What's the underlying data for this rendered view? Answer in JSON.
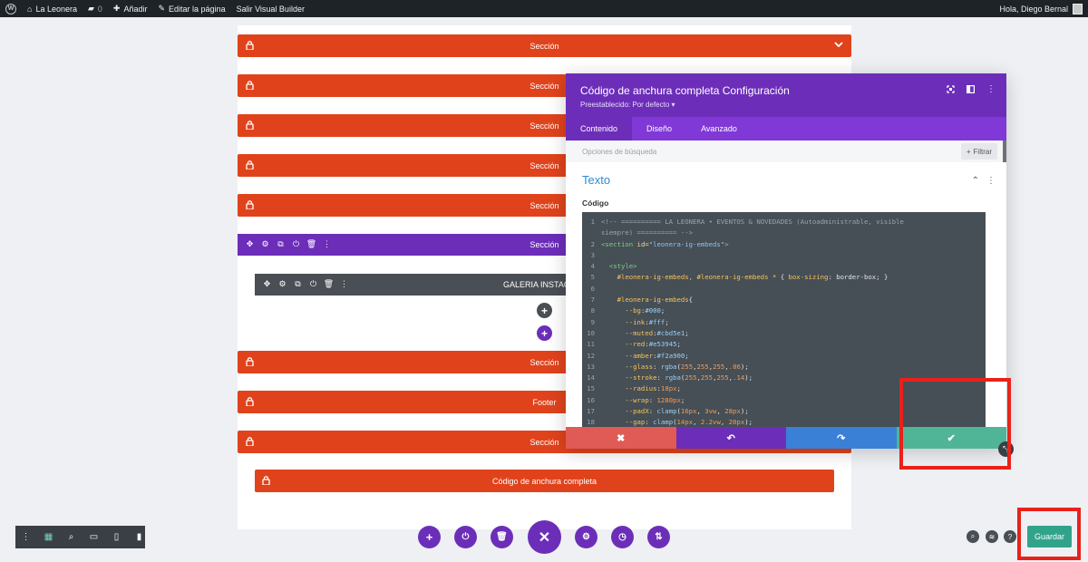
{
  "adminbar": {
    "site_name": "La Leonera",
    "comments_count": "0",
    "add_label": "Añadir",
    "edit_page_label": "Editar la página",
    "exit_builder_label": "Salir Visual Builder",
    "greeting": "Hola, Diego Bernal"
  },
  "builder": {
    "sections": [
      "Sección",
      "Sección",
      "Sección",
      "Sección",
      "Sección",
      "Sección",
      "Sección",
      "Footer",
      "Sección"
    ],
    "row_module_label": "GALERIA INSTAGR",
    "fullwidth_module_label": "Código de anchura completa"
  },
  "modal": {
    "title": "Código de anchura completa Configuración",
    "preset": "Preestablecido: Por defecto",
    "tabs": [
      "Contenido",
      "Diseño",
      "Avanzado"
    ],
    "active_tab": "Contenido",
    "search_placeholder": "Opciones de búsqueda",
    "filter_label": "Filtrar",
    "group_title": "Texto",
    "code_label": "Código",
    "code_lines": [
      {
        "n": "1",
        "parts": [
          [
            "cm",
            "<!-- ========== LA LEONERA • EVENTOS & NOVEDADES (Autoadministrable, visible"
          ]
        ]
      },
      {
        "n": "",
        "parts": [
          [
            "cm",
            "siempre) ========== -->"
          ]
        ]
      },
      {
        "n": "2",
        "parts": [
          [
            "tg",
            "<section "
          ],
          [
            "at",
            "id="
          ],
          [
            "st",
            "\"leonera-ig-embeds\""
          ],
          [
            "tg",
            ">"
          ]
        ]
      },
      {
        "n": "3",
        "parts": []
      },
      {
        "n": "4",
        "parts": [
          [
            "pl",
            "  "
          ],
          [
            "tg",
            "<style>"
          ]
        ]
      },
      {
        "n": "5",
        "parts": [
          [
            "pl",
            "    "
          ],
          [
            "sel",
            "#leonera-ig-embeds, #leonera-ig-embeds * "
          ],
          [
            "pl",
            "{ "
          ],
          [
            "pr",
            "box-sizing"
          ],
          [
            "pl",
            ": border-box; }"
          ]
        ]
      },
      {
        "n": "6",
        "parts": []
      },
      {
        "n": "7",
        "parts": [
          [
            "pl",
            "    "
          ],
          [
            "sel",
            "#leonera-ig-embeds"
          ],
          [
            "pl",
            "{"
          ]
        ]
      },
      {
        "n": "8",
        "parts": [
          [
            "pl",
            "      "
          ],
          [
            "pr",
            "--bg"
          ],
          [
            "pl",
            ":"
          ],
          [
            "vl",
            "#000"
          ],
          [
            "pl",
            ";"
          ]
        ]
      },
      {
        "n": "9",
        "parts": [
          [
            "pl",
            "      "
          ],
          [
            "pr",
            "--ink"
          ],
          [
            "pl",
            ":"
          ],
          [
            "vl",
            "#fff"
          ],
          [
            "pl",
            ";"
          ]
        ]
      },
      {
        "n": "10",
        "parts": [
          [
            "pl",
            "      "
          ],
          [
            "pr",
            "--muted"
          ],
          [
            "pl",
            ":"
          ],
          [
            "vl",
            "#cbd5e1"
          ],
          [
            "pl",
            ";"
          ]
        ]
      },
      {
        "n": "11",
        "parts": [
          [
            "pl",
            "      "
          ],
          [
            "pr",
            "--red"
          ],
          [
            "pl",
            ":"
          ],
          [
            "vl",
            "#e53945"
          ],
          [
            "pl",
            ";"
          ]
        ]
      },
      {
        "n": "12",
        "parts": [
          [
            "pl",
            "      "
          ],
          [
            "pr",
            "--amber"
          ],
          [
            "pl",
            ":"
          ],
          [
            "vl",
            "#f2a900"
          ],
          [
            "pl",
            ";"
          ]
        ]
      },
      {
        "n": "13",
        "parts": [
          [
            "pl",
            "      "
          ],
          [
            "pr",
            "--glass"
          ],
          [
            "pl",
            ": "
          ],
          [
            "vl",
            "rgba"
          ],
          [
            "pl",
            "("
          ],
          [
            "nm",
            "255"
          ],
          [
            "pl",
            ","
          ],
          [
            "nm",
            "255"
          ],
          [
            "pl",
            ","
          ],
          [
            "nm",
            "255"
          ],
          [
            "pl",
            ","
          ],
          [
            "nm",
            ".06"
          ],
          [
            "pl",
            ");"
          ]
        ]
      },
      {
        "n": "14",
        "parts": [
          [
            "pl",
            "      "
          ],
          [
            "pr",
            "--stroke"
          ],
          [
            "pl",
            ": "
          ],
          [
            "vl",
            "rgba"
          ],
          [
            "pl",
            "("
          ],
          [
            "nm",
            "255"
          ],
          [
            "pl",
            ","
          ],
          [
            "nm",
            "255"
          ],
          [
            "pl",
            ","
          ],
          [
            "nm",
            "255"
          ],
          [
            "pl",
            ","
          ],
          [
            "nm",
            ".14"
          ],
          [
            "pl",
            ");"
          ]
        ]
      },
      {
        "n": "15",
        "parts": [
          [
            "pl",
            "      "
          ],
          [
            "pr",
            "--radius"
          ],
          [
            "pl",
            ":"
          ],
          [
            "nm",
            "18px"
          ],
          [
            "pl",
            ";"
          ]
        ]
      },
      {
        "n": "16",
        "parts": [
          [
            "pl",
            "      "
          ],
          [
            "pr",
            "--wrap"
          ],
          [
            "pl",
            ": "
          ],
          [
            "nm",
            "1280px"
          ],
          [
            "pl",
            ";"
          ]
        ]
      },
      {
        "n": "17",
        "parts": [
          [
            "pl",
            "      "
          ],
          [
            "pr",
            "--padX"
          ],
          [
            "pl",
            ": "
          ],
          [
            "vl",
            "clamp"
          ],
          [
            "pl",
            "("
          ],
          [
            "nm",
            "16px"
          ],
          [
            "pl",
            ", "
          ],
          [
            "nm",
            "3vw"
          ],
          [
            "pl",
            ", "
          ],
          [
            "nm",
            "28px"
          ],
          [
            "pl",
            ");"
          ]
        ]
      },
      {
        "n": "18",
        "parts": [
          [
            "pl",
            "      "
          ],
          [
            "pr",
            "--gap"
          ],
          [
            "pl",
            ": "
          ],
          [
            "vl",
            "clamp"
          ],
          [
            "pl",
            "("
          ],
          [
            "nm",
            "14px"
          ],
          [
            "pl",
            ", "
          ],
          [
            "nm",
            "2.2vw"
          ],
          [
            "pl",
            ", "
          ],
          [
            "nm",
            "20px"
          ],
          [
            "pl",
            ");"
          ]
        ]
      }
    ]
  },
  "save_button_label": "Guardar",
  "colors": {
    "section_orange": "#e0431c",
    "builder_purple": "#6c2eb9",
    "cancel_red": "#e05a56",
    "undo_purple": "#6c2eb9",
    "redo_blue": "#3a80d6",
    "confirm_green": "#4fb596",
    "highlight_red": "#e8221b"
  }
}
